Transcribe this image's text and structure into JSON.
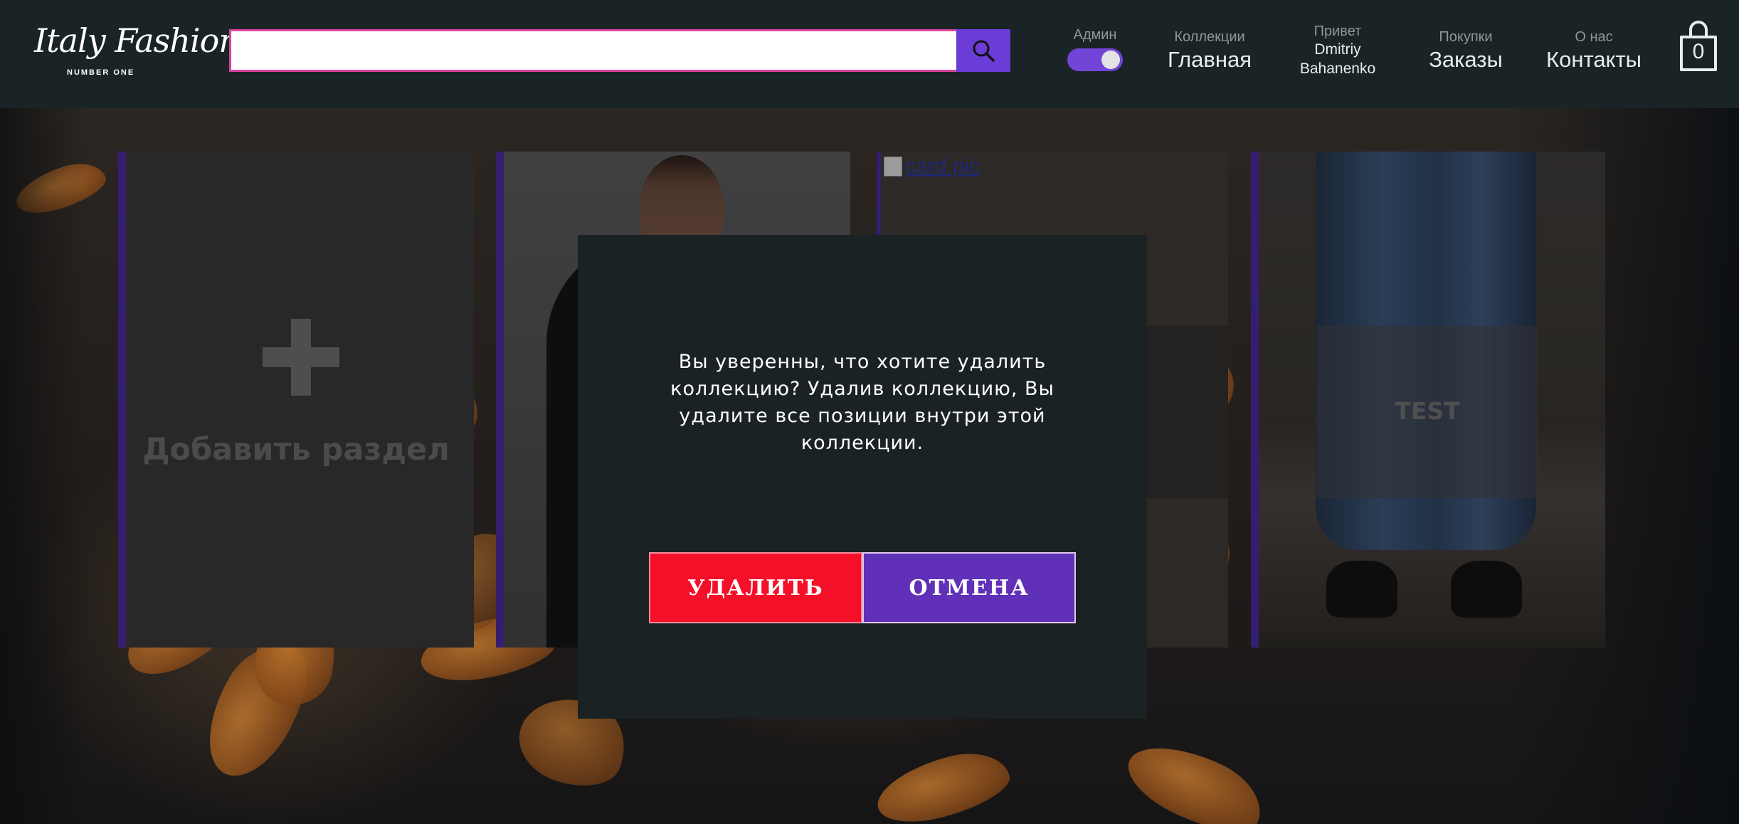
{
  "header": {
    "logo": {
      "main": "Italy Fashion",
      "sub": "NUMBER ONE"
    },
    "search": {
      "value": "",
      "placeholder": ""
    },
    "admin_toggle": {
      "label": "Админ",
      "checked": true
    },
    "nav": [
      {
        "small": "Коллекции",
        "big": "Главная"
      },
      {
        "small": "Привет",
        "user_first": "Dmitriy",
        "user_last": "Bahanenko"
      },
      {
        "small": "Покупки",
        "big": "Заказы"
      },
      {
        "small": "О нас",
        "big": "Контакты"
      }
    ],
    "cart": {
      "count": "0"
    }
  },
  "cards": {
    "add_label": "Добавить раздел",
    "broken_alt": "card pic",
    "test_label": "TEST"
  },
  "modal": {
    "message": "Вы уверенны, что хотите удалить коллекцию? Удалив коллекцию, Вы удалите все позиции внутри этой коллекции.",
    "delete_label": "УДАЛИТЬ",
    "cancel_label": "ОТМЕНА"
  },
  "colors": {
    "accent": "#6b3cd6",
    "delete": "#f5102a",
    "cancel": "#6030b8",
    "header_bg": "#1a2426",
    "search_border": "#d8449c"
  },
  "icons": [
    "search-icon",
    "cart-icon",
    "plus-icon",
    "broken-image-icon"
  ]
}
